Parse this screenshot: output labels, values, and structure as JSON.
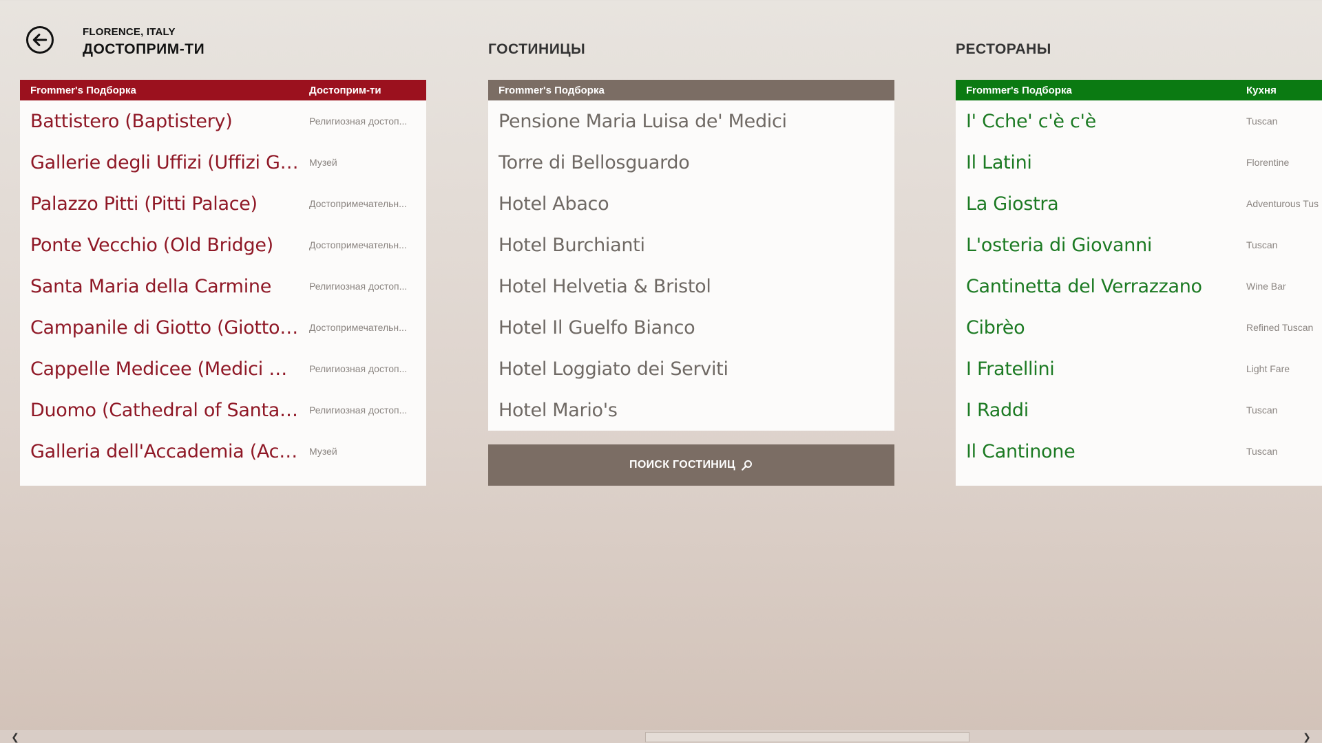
{
  "header": {
    "breadcrumb": "FLORENCE, ITALY",
    "title": "ДОСТОПРИМ-ТИ"
  },
  "sights": {
    "header_left": "Frommer's Подборка",
    "header_right": "Достоприм-ти",
    "items": [
      {
        "name": "Battistero (Baptistery)",
        "category": "Религиозная достоп..."
      },
      {
        "name": "Gallerie degli Uffizi (Uffizi Gall...",
        "category": "Музей"
      },
      {
        "name": "Palazzo Pitti (Pitti Palace)",
        "category": "Достопримечательн..."
      },
      {
        "name": "Ponte Vecchio (Old Bridge)",
        "category": "Достопримечательн..."
      },
      {
        "name": "Santa Maria della Carmine",
        "category": "Религиозная достоп..."
      },
      {
        "name": "Campanile di Giotto (Giotto's...",
        "category": "Достопримечательн..."
      },
      {
        "name": "Cappelle Medicee (Medici Cha...",
        "category": "Религиозная достоп..."
      },
      {
        "name": "Duomo (Cathedral of Santa M...",
        "category": "Религиозная достоп..."
      },
      {
        "name": "Galleria dell'Accademia (Acade...",
        "category": "Музей"
      }
    ]
  },
  "hotels": {
    "section_title": "ГОСТИНИЦЫ",
    "header_left": "Frommer's Подборка",
    "items": [
      {
        "name": "Pensione Maria Luisa de' Medici"
      },
      {
        "name": "Torre di Bellosguardo"
      },
      {
        "name": "Hotel Abaco"
      },
      {
        "name": "Hotel Burchianti"
      },
      {
        "name": "Hotel Helvetia & Bristol"
      },
      {
        "name": "Hotel Il Guelfo Bianco"
      },
      {
        "name": "Hotel Loggiato dei Serviti"
      },
      {
        "name": "Hotel Mario's"
      }
    ],
    "search_button": "ПОИСК ГОСТИНИЦ"
  },
  "restaurants": {
    "section_title": "РЕСТОРАНЫ",
    "header_left": "Frommer's Подборка",
    "header_right": "Кухня",
    "items": [
      {
        "name": "I' Cche' c'è c'è",
        "category": "Tuscan"
      },
      {
        "name": "Il Latini",
        "category": "Florentine"
      },
      {
        "name": "La Giostra",
        "category": "Adventurous Tus"
      },
      {
        "name": "L'osteria di Giovanni",
        "category": "Tuscan"
      },
      {
        "name": "Cantinetta del Verrazzano",
        "category": "Wine Bar"
      },
      {
        "name": "Cibrèo",
        "category": "Refined Tuscan"
      },
      {
        "name": "I Fratellini",
        "category": "Light Fare"
      },
      {
        "name": "I Raddi",
        "category": "Tuscan"
      },
      {
        "name": "Il Cantinone",
        "category": "Tuscan"
      }
    ]
  },
  "colors": {
    "sights_accent": "#9b111e",
    "hotels_accent": "#7b6d64",
    "restaurants_accent": "#0b7a12"
  },
  "icons": {
    "back": "back-arrow-icon",
    "search": "search-icon",
    "scroll_left": "chevron-left-icon",
    "scroll_right": "chevron-right-icon"
  }
}
